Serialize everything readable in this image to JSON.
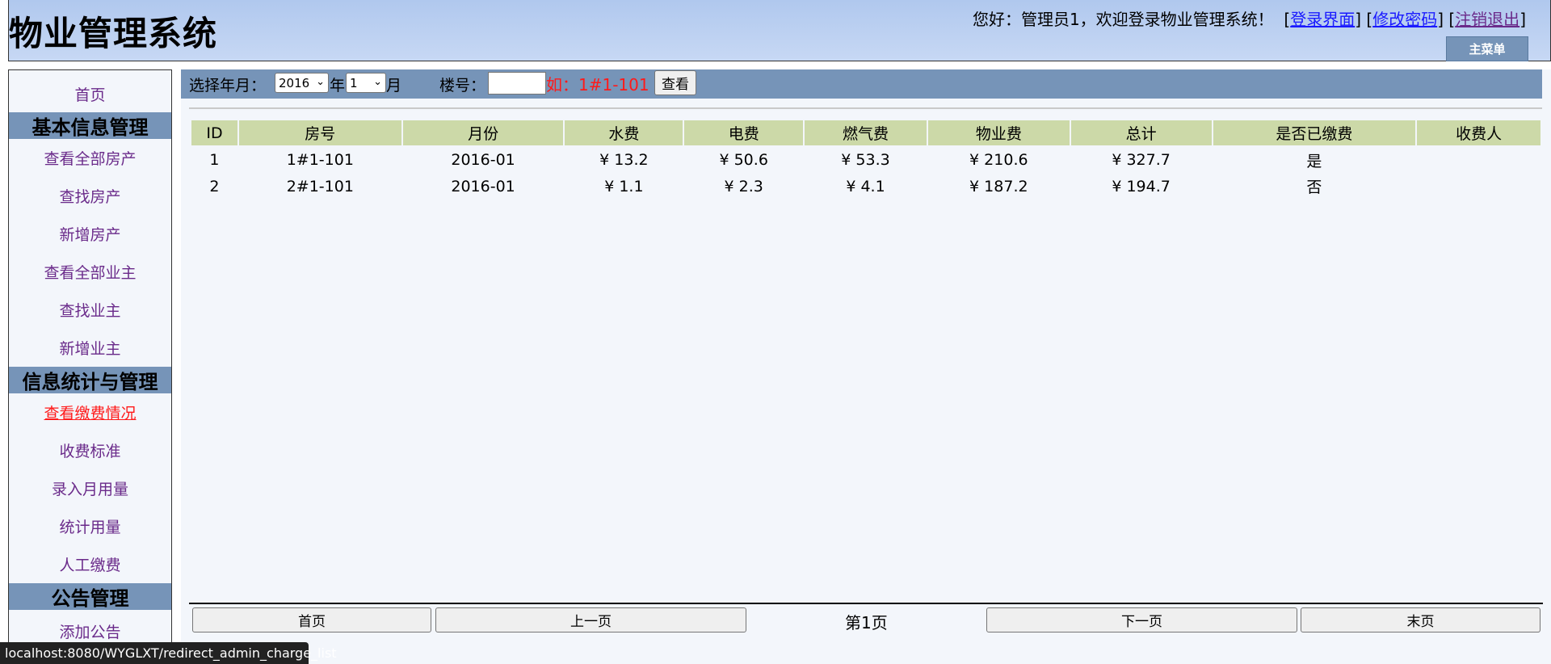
{
  "header": {
    "title": "物业管理系统",
    "welcome_text": "您好：管理员1，欢迎登录物业管理系统！",
    "links": [
      "登录界面",
      "修改密码",
      "注销退出"
    ],
    "main_menu_label": "主菜单"
  },
  "sidebar": {
    "home": "首页",
    "sections": [
      {
        "title": "基本信息管理",
        "items": [
          "查看全部房产",
          "查找房产",
          "新增房产",
          "查看全部业主",
          "查找业主",
          "新增业主"
        ]
      },
      {
        "title": "信息统计与管理",
        "items": [
          "查看缴费情况",
          "收费标准",
          "录入月用量",
          "统计用量",
          "人工缴费"
        ]
      },
      {
        "title": "公告管理",
        "items": [
          "添加公告"
        ]
      }
    ],
    "active_item": "查看缴费情况"
  },
  "filter": {
    "year_label": "选择年月：",
    "year_value": "2016",
    "year_unit": "年",
    "month_value": "1",
    "month_unit": "月",
    "building_label": "楼号：",
    "building_value": "",
    "hint": "如：1#1-101",
    "query_button": "查看"
  },
  "table": {
    "columns": [
      "ID",
      "房号",
      "月份",
      "水费",
      "电费",
      "燃气费",
      "物业费",
      "总计",
      "是否已缴费",
      "收费人"
    ],
    "rows": [
      [
        "1",
        "1#1-101",
        "2016-01",
        "¥ 13.2",
        "¥ 50.6",
        "¥ 53.3",
        "¥ 210.6",
        "¥ 327.7",
        "是",
        ""
      ],
      [
        "2",
        "2#1-101",
        "2016-01",
        "¥ 1.1",
        "¥ 2.3",
        "¥ 4.1",
        "¥ 187.2",
        "¥ 194.7",
        "否",
        ""
      ]
    ]
  },
  "pager": {
    "first": "首页",
    "prev": "上一页",
    "current": "第1页",
    "next": "下一页",
    "last": "末页"
  },
  "status_bar": {
    "url": "localhost:8080/WYGLXT/redirect_admin_charge_list"
  },
  "colors": {
    "header_bg": "#b0c8ee",
    "nav_blue": "#7694b8",
    "table_header": "#ccd9a8",
    "active_link": "#ff1a1a",
    "visited_link": "#6a2a8a"
  }
}
